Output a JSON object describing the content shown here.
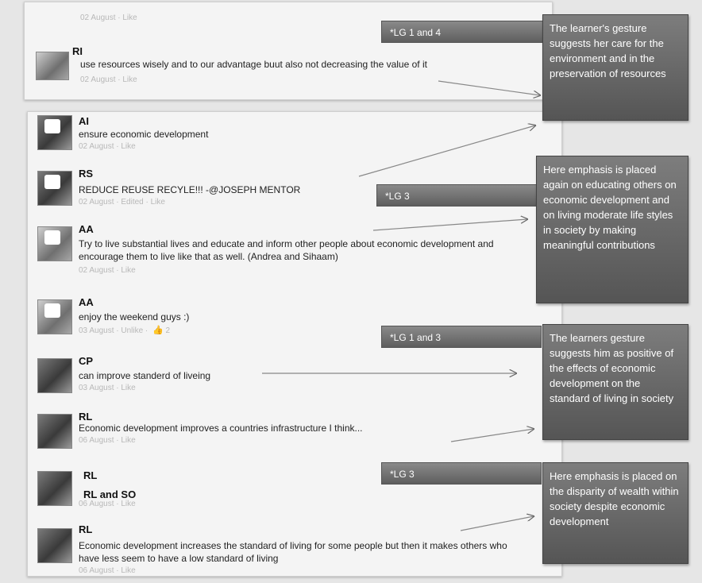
{
  "top_panel": {
    "faded_meta": "02 August · Like",
    "post": {
      "name": "RI",
      "text": "use resources wisely and to our advantage buut also not decreasing the value of it",
      "meta": "02 August · Like"
    }
  },
  "posts": [
    {
      "name": "AI",
      "text": "ensure economic development",
      "meta": "02 August · Like"
    },
    {
      "name": "RS",
      "text": "REDUCE REUSE RECYLE!!! -@JOSEPH MENTOR",
      "meta": "02 August · Edited · Like"
    },
    {
      "name": "AA",
      "text": "Try to live substantial lives and educate and inform other people about economic development and encourage them to live like that as well. (Andrea and Sihaam)",
      "meta": "02 August · Like"
    },
    {
      "name": "AA",
      "text": "enjoy the weekend guys :)",
      "meta": "03 August · Unlike ·",
      "likes": "2"
    },
    {
      "name": "CP",
      "text": "can improve standerd of liveing",
      "meta": "03 August · Like"
    },
    {
      "name": "RL",
      "text": "Economic development improves a countries infrastructure I think...",
      "meta": "06 August · Like"
    },
    {
      "name": "RL",
      "subname": "RL and SO",
      "text": "",
      "meta": "06 August · Like"
    },
    {
      "name": "RL",
      "text": "Economic development increases the standard of living for some people but then it makes others who have less seem to have a low standard of living",
      "meta": "06 August · Like"
    }
  ],
  "tags": [
    "*LG 1 and 4",
    "*LG 3",
    "*LG 1 and 3",
    "*LG 3"
  ],
  "notes": [
    "The learner's gesture suggests her care for the environment and in the preservation of resources",
    "Here emphasis is placed again on educating others on economic development and on living moderate life styles in society by making meaningful contributions",
    "The learners gesture suggests him as positive of the effects of economic development on the standard of living in society",
    "Here emphasis is placed on the disparity of wealth within society despite economic development"
  ],
  "icons": {
    "like": "thumbs-up-icon"
  }
}
